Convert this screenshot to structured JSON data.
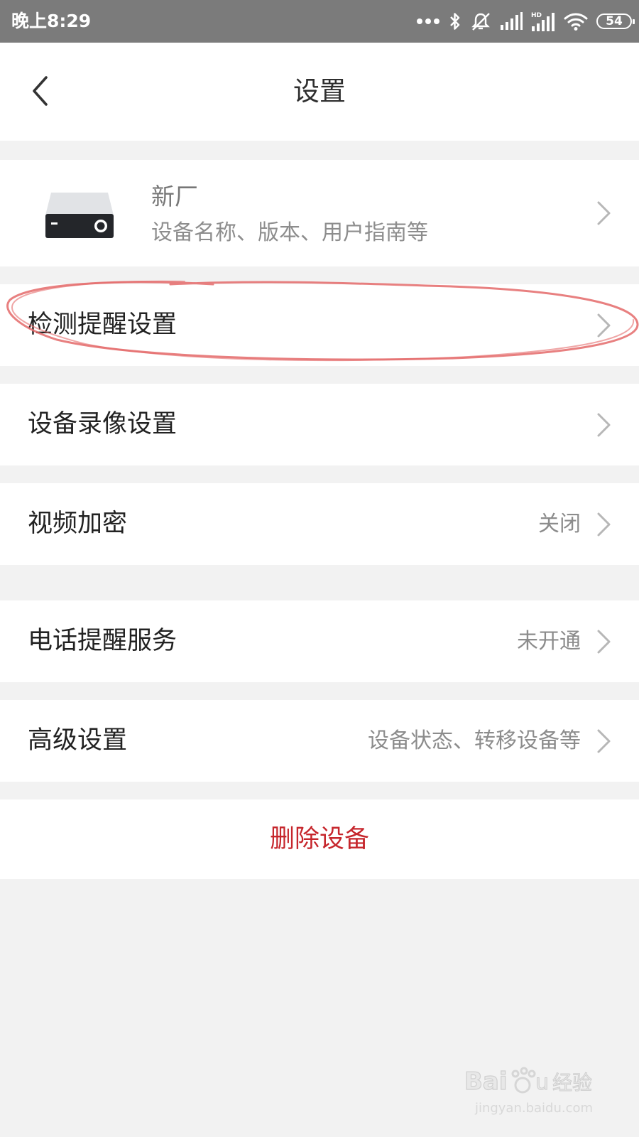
{
  "status_bar": {
    "time": "晚上8:29",
    "battery_level": "54",
    "icons": [
      "more-dots-icon",
      "bluetooth-icon",
      "mute-icon",
      "signal-icon",
      "hd-signal-icon",
      "wifi-icon",
      "battery-icon"
    ]
  },
  "header": {
    "title": "设置",
    "back_icon": "chevron-left-icon"
  },
  "device": {
    "name": "新厂",
    "description": "设备名称、版本、用户指南等",
    "icon": "nvr-device-icon"
  },
  "settings": [
    {
      "label": "检测提醒设置",
      "value": ""
    },
    {
      "label": "设备录像设置",
      "value": ""
    },
    {
      "label": "视频加密",
      "value": "关闭"
    },
    {
      "label": "电话提醒服务",
      "value": "未开通"
    },
    {
      "label": "高级设置",
      "value": "设备状态、转移设备等"
    }
  ],
  "delete_label": "删除设备",
  "colors": {
    "status_bar": "#7b7b7b",
    "page_background": "#f2f2f2",
    "danger": "#c6262c",
    "annotation": "#e46a6a"
  },
  "watermark": {
    "url": "jingyan.baidu.com"
  }
}
